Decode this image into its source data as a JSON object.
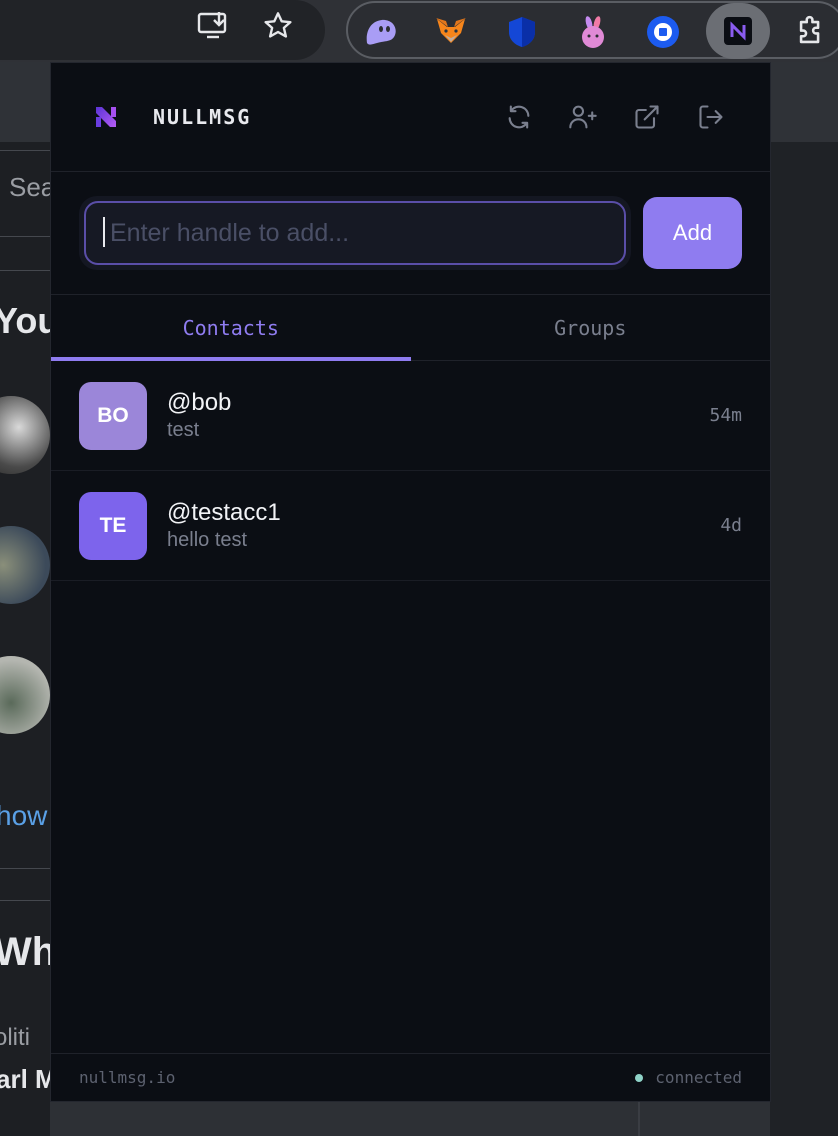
{
  "browser": {
    "toolbar_icons": [
      "install-icon",
      "bookmark-star-icon"
    ],
    "extensions": [
      "ghost-extension-icon",
      "metamask-fox-icon",
      "shield-extension-icon",
      "bunny-extension-icon",
      "coinbase-extension-icon",
      "nullmsg-extension-icon",
      "puzzle-extensions-icon"
    ]
  },
  "background_page": {
    "search_fragment": "Sea",
    "heading_fragment": "You",
    "link_fragment": "how",
    "heading2_fragment": "Wha",
    "text_fragment": "oliti",
    "bold_fragment": "arl M"
  },
  "popup": {
    "brand": {
      "name": "NULLMSG",
      "logo": "nullmsg-logo-icon"
    },
    "header_actions": [
      "refresh-icon",
      "add-contact-icon",
      "open-external-icon",
      "logout-icon"
    ],
    "add": {
      "placeholder": "Enter handle to add...",
      "value": "",
      "button_label": "Add"
    },
    "tabs": [
      {
        "label": "Contacts",
        "active": true
      },
      {
        "label": "Groups",
        "active": false
      }
    ],
    "contacts": [
      {
        "initials": "BO",
        "handle": "@bob",
        "preview": "test",
        "time": "54m",
        "color": "#9b86d9"
      },
      {
        "initials": "TE",
        "handle": "@testacc1",
        "preview": "hello test",
        "time": "4d",
        "color": "#7d64ec"
      }
    ],
    "footer": {
      "domain": "nullmsg.io",
      "status": "connected",
      "status_color": "#8fd3c8"
    }
  },
  "colors": {
    "accent": "#8f7cf0",
    "background": "#0b0e14"
  }
}
